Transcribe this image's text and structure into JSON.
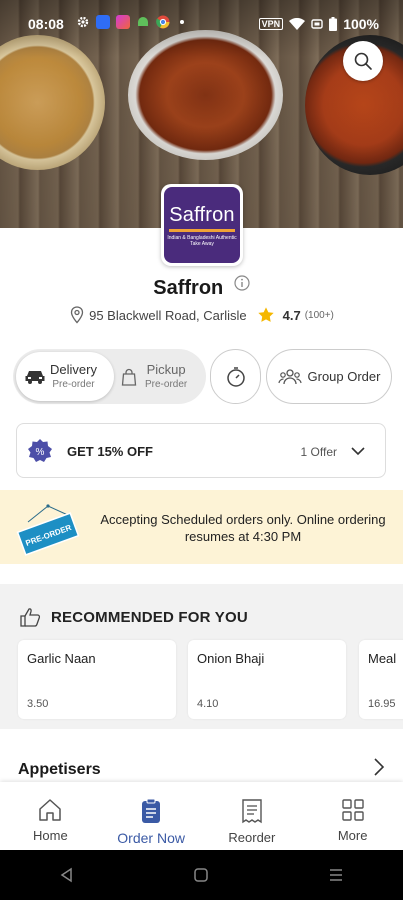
{
  "status_bar": {
    "time": "08:08",
    "battery": "100%",
    "vpn": "VPN"
  },
  "colors": {
    "accent": "#3b5aa5",
    "brand_purple": "#4a2b7c",
    "brand_orange": "#f0a236",
    "notice_bg": "#fdf3d6",
    "star": "#f5b700"
  },
  "restaurant": {
    "logo_word": "Saffron",
    "logo_sub": "Indian & Bangladeshi Authentic Take Away",
    "name": "Saffron",
    "address": "95 Blackwell Road, Carlisle",
    "rating": "4.7",
    "reviews": "(100+)"
  },
  "service": {
    "delivery": {
      "title": "Delivery",
      "sub": "Pre-order"
    },
    "pickup": {
      "title": "Pickup",
      "sub": "Pre-order"
    },
    "group_order": "Group Order"
  },
  "offer": {
    "title": "GET 15% OFF",
    "count": "1 Offer"
  },
  "notice": {
    "sign": "PRE-ORDER",
    "text": "Accepting Scheduled orders only. Online ordering resumes at 4:30 PM"
  },
  "recommended": {
    "title": "RECOMMENDED FOR YOU",
    "items": [
      {
        "name": "Garlic Naan",
        "price": "3.50"
      },
      {
        "name": "Onion Bhaji",
        "price": "4.10"
      },
      {
        "name": "Meal",
        "price": "16.95"
      }
    ]
  },
  "section": {
    "title": "Appetisers"
  },
  "nav": {
    "home": "Home",
    "order_now": "Order Now",
    "reorder": "Reorder",
    "more": "More"
  }
}
